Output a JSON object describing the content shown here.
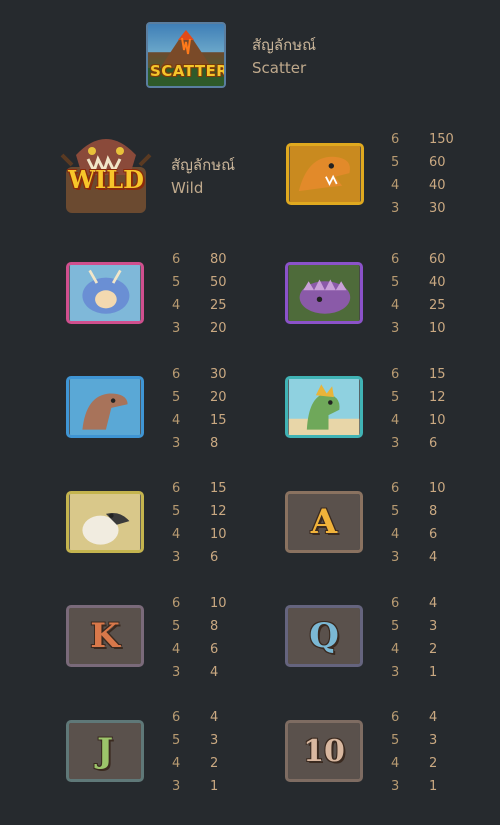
{
  "scatter": {
    "label_th": "สัญลักษณ์",
    "label_en": "Scatter",
    "badge": "SCATTER",
    "icon": "volcano-scatter-icon"
  },
  "wild": {
    "label_th": "สัญลักษณ์",
    "label_en": "Wild",
    "badge": "WILD",
    "icon": "trex-skull-wild-icon"
  },
  "symbols": [
    {
      "name": "t-rex-symbol",
      "icon": "t-rex-icon",
      "frame": "#e0a91f",
      "glyph": "",
      "pays": [
        [
          "6",
          "150"
        ],
        [
          "5",
          "60"
        ],
        [
          "4",
          "40"
        ],
        [
          "3",
          "30"
        ]
      ]
    },
    {
      "name": "triceratops-symbol",
      "icon": "triceratops-icon",
      "frame": "#d04f8e",
      "glyph": "",
      "pays": [
        [
          "6",
          "80"
        ],
        [
          "5",
          "50"
        ],
        [
          "4",
          "25"
        ],
        [
          "3",
          "20"
        ]
      ]
    },
    {
      "name": "ankylosaurus-symbol",
      "icon": "ankylosaurus-icon",
      "frame": "#8b52c9",
      "glyph": "",
      "pays": [
        [
          "6",
          "60"
        ],
        [
          "5",
          "40"
        ],
        [
          "4",
          "25"
        ],
        [
          "3",
          "10"
        ]
      ]
    },
    {
      "name": "raptor-symbol",
      "icon": "raptor-icon",
      "frame": "#3f95d4",
      "glyph": "",
      "pays": [
        [
          "6",
          "30"
        ],
        [
          "5",
          "20"
        ],
        [
          "4",
          "15"
        ],
        [
          "3",
          "8"
        ]
      ]
    },
    {
      "name": "dilophosaurus-symbol",
      "icon": "dilophosaurus-icon",
      "frame": "#40b3b5",
      "glyph": "",
      "pays": [
        [
          "6",
          "15"
        ],
        [
          "5",
          "12"
        ],
        [
          "4",
          "10"
        ],
        [
          "3",
          "6"
        ]
      ]
    },
    {
      "name": "dodo-symbol",
      "icon": "dodo-icon",
      "frame": "#c4b44e",
      "glyph": "",
      "pays": [
        [
          "6",
          "15"
        ],
        [
          "5",
          "12"
        ],
        [
          "4",
          "10"
        ],
        [
          "3",
          "6"
        ]
      ]
    },
    {
      "name": "a-symbol",
      "icon": "letter-a-icon",
      "frame": "#8a7260",
      "glyph": "A",
      "pays": [
        [
          "6",
          "10"
        ],
        [
          "5",
          "8"
        ],
        [
          "4",
          "6"
        ],
        [
          "3",
          "4"
        ]
      ]
    },
    {
      "name": "k-symbol",
      "icon": "letter-k-icon",
      "frame": "#7a6a7a",
      "glyph": "K",
      "pays": [
        [
          "6",
          "10"
        ],
        [
          "5",
          "8"
        ],
        [
          "4",
          "6"
        ],
        [
          "3",
          "4"
        ]
      ]
    },
    {
      "name": "q-symbol",
      "icon": "letter-q-icon",
      "frame": "#65647e",
      "glyph": "Q",
      "pays": [
        [
          "6",
          "4"
        ],
        [
          "5",
          "3"
        ],
        [
          "4",
          "2"
        ],
        [
          "3",
          "1"
        ]
      ]
    },
    {
      "name": "j-symbol",
      "icon": "letter-j-icon",
      "frame": "#5f7878",
      "glyph": "J",
      "pays": [
        [
          "6",
          "4"
        ],
        [
          "5",
          "3"
        ],
        [
          "4",
          "2"
        ],
        [
          "3",
          "1"
        ]
      ]
    },
    {
      "name": "ten-symbol",
      "icon": "number-10-icon",
      "frame": "#7e6c62",
      "glyph": "10",
      "pays": [
        [
          "6",
          "4"
        ],
        [
          "5",
          "3"
        ],
        [
          "4",
          "2"
        ],
        [
          "3",
          "1"
        ]
      ]
    }
  ],
  "colors": {
    "background": "#262a2e",
    "count": "#b89b72",
    "payout": "#caa982",
    "label": "#c9b59a"
  }
}
